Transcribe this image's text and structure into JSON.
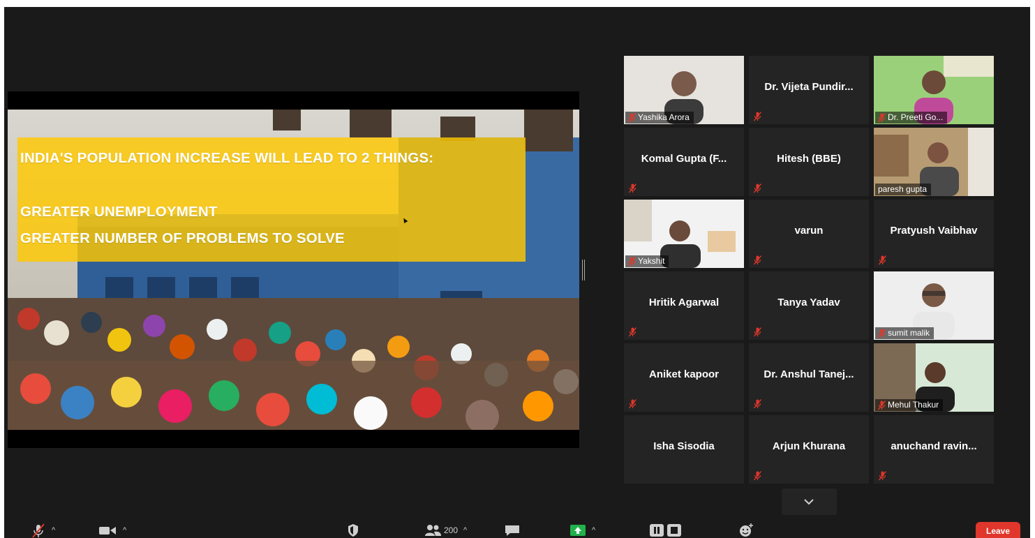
{
  "slide": {
    "heading": "INDIA'S POPULATION INCREASE WILL LEAD TO 2 THINGS:",
    "points": [
      "GREATER UNEMPLOYMENT",
      "GREATER NUMBER OF PROBLEMS TO SOLVE"
    ]
  },
  "participants": [
    {
      "name": "Yashika Arora",
      "video": true,
      "muted": true
    },
    {
      "name": "Dr. Vijeta Pundir...",
      "video": false,
      "muted": true
    },
    {
      "name": "Dr. Preeti Go...",
      "video": true,
      "muted": true
    },
    {
      "name": "Komal Gupta (F...",
      "video": false,
      "muted": true
    },
    {
      "name": "Hitesh (BBE)",
      "video": false,
      "muted": true
    },
    {
      "name": "paresh gupta",
      "video": true,
      "muted": false,
      "speaking": true
    },
    {
      "name": "Yakshit",
      "video": true,
      "muted": true
    },
    {
      "name": "varun",
      "video": false,
      "muted": true
    },
    {
      "name": "Pratyush Vaibhav",
      "video": false,
      "muted": true
    },
    {
      "name": "Hritik Agarwal",
      "video": false,
      "muted": true
    },
    {
      "name": "Tanya Yadav",
      "video": false,
      "muted": true
    },
    {
      "name": "sumit malik",
      "video": true,
      "muted": true
    },
    {
      "name": "Aniket kapoor",
      "video": false,
      "muted": true
    },
    {
      "name": "Dr. Anshul Tanej...",
      "video": false,
      "muted": true
    },
    {
      "name": "Mehul Thakur",
      "video": true,
      "muted": true
    },
    {
      "name": "Isha Sisodia",
      "video": false,
      "muted": false
    },
    {
      "name": "Arjun Khurana",
      "video": false,
      "muted": true
    },
    {
      "name": "anuchand  ravin...",
      "video": false,
      "muted": true
    }
  ],
  "toolbar": {
    "participant_count": "200",
    "leave_label": "Leave",
    "icons": [
      "mic-muted-icon",
      "video-camera-icon",
      "security-shield-icon",
      "participants-icon",
      "chat-icon",
      "share-screen-icon",
      "record-icon",
      "reactions-icon"
    ]
  },
  "colors": {
    "mute": "#e0362b",
    "banner": "#ffc800",
    "speaking_border": "#c9d86a",
    "share": "#22b14c"
  }
}
